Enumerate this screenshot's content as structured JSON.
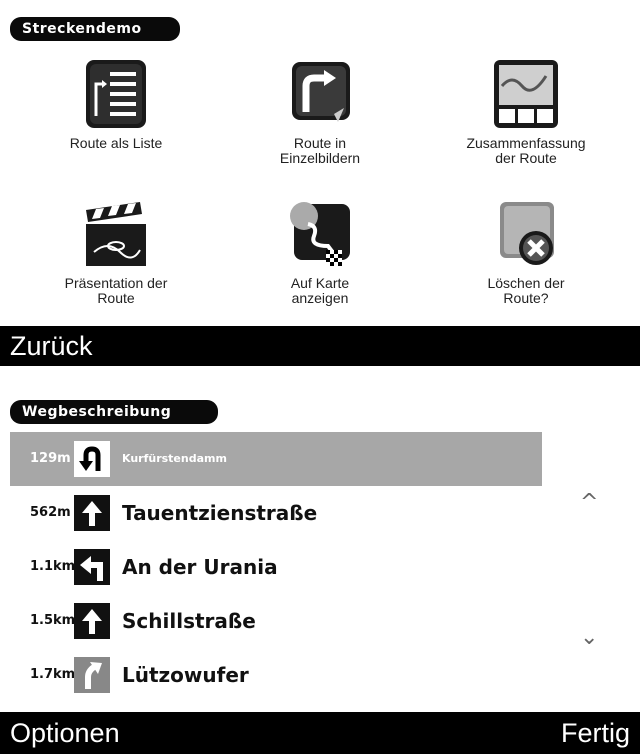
{
  "section1": {
    "title": "Streckendemo",
    "items": [
      {
        "label": "Route als Liste",
        "icon": "route-list-icon"
      },
      {
        "label": "Route in\nEinzelbildern",
        "icon": "route-images-icon"
      },
      {
        "label": "Zusammenfassung\nder Route",
        "icon": "route-summary-icon"
      },
      {
        "label": "Präsentation der\nRoute",
        "icon": "clapperboard-icon"
      },
      {
        "label": "Auf Karte\nanzeigen",
        "icon": "map-route-icon"
      },
      {
        "label": "Löschen der\nRoute?",
        "icon": "delete-route-icon"
      }
    ],
    "back_label": "Zurück"
  },
  "section2": {
    "title": "Wegbeschreibung",
    "rows": [
      {
        "distance": "129m",
        "street": "Kurfürstendamm",
        "icon": "u-turn-icon",
        "selected": true
      },
      {
        "distance": "562m",
        "street": "Tauentzienstraße",
        "icon": "straight-arrow-icon",
        "selected": false
      },
      {
        "distance": "1.1km",
        "street": "An der Urania",
        "icon": "turn-left-icon",
        "selected": false
      },
      {
        "distance": "1.5km",
        "street": "Schillstraße",
        "icon": "straight-arrow-icon",
        "selected": false
      },
      {
        "distance": "1.7km",
        "street": "Lützowufer",
        "icon": "bear-right-icon",
        "selected": false
      }
    ],
    "scroll_up": "^",
    "scroll_down": "⌄",
    "options_label": "Optionen",
    "done_label": "Fertig"
  }
}
